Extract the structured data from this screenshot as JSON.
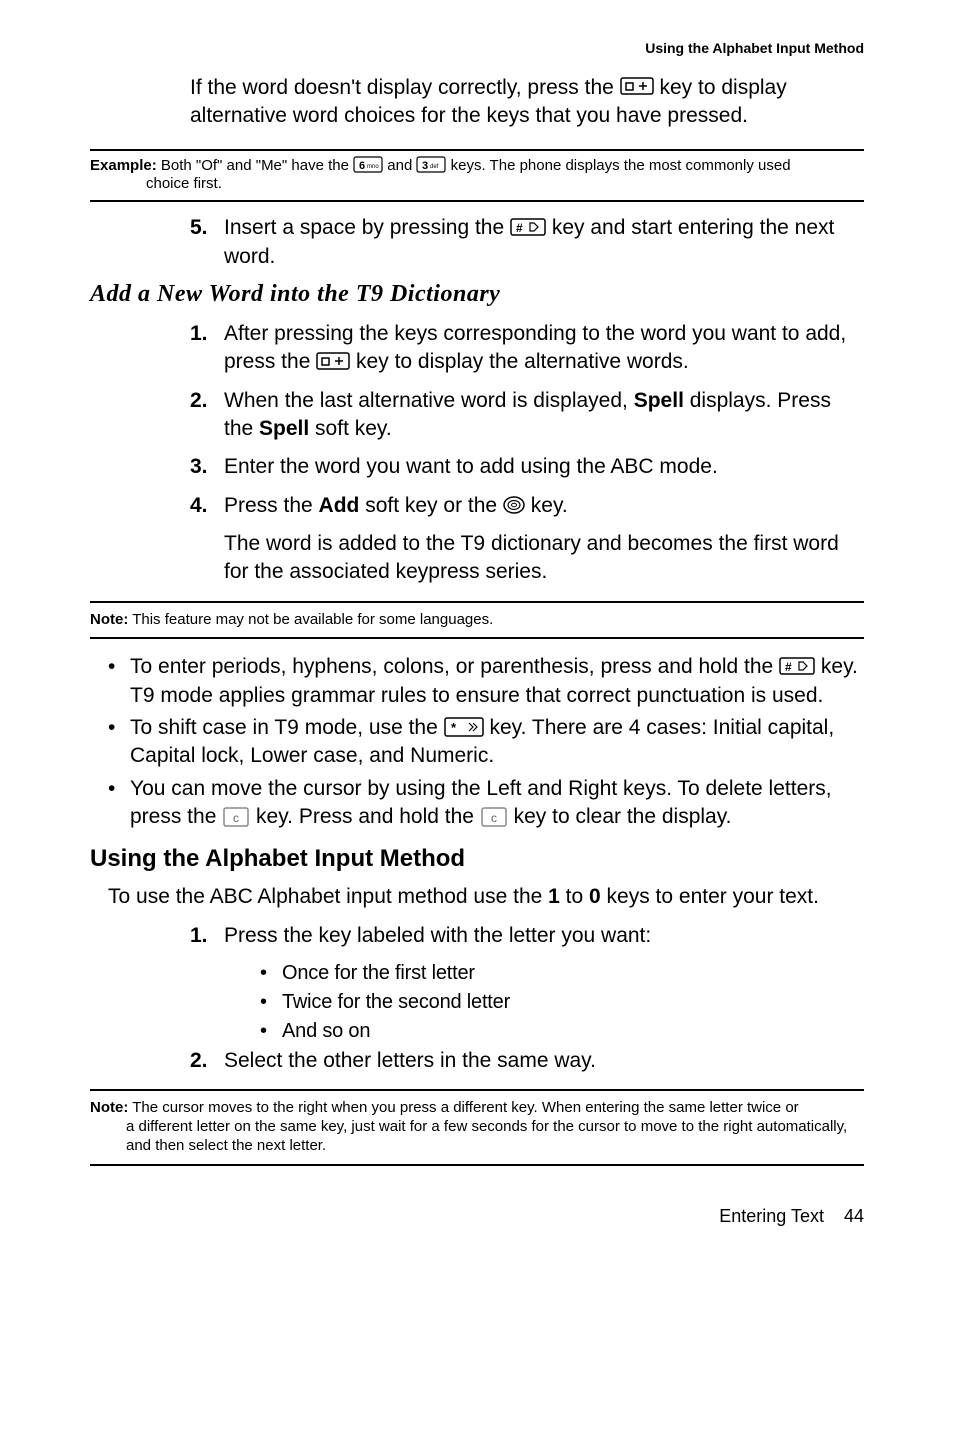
{
  "header": "Using the Alphabet Input Method",
  "intro_para": "If the word doesn't display correctly, press the {key0} key to display alternative word choices for the keys that you have pressed.",
  "example": {
    "label": "Example:",
    "text_a": " Both \"Of\" and \"Me\" have the {key6} and {key3} keys. The phone displays the most commonly used",
    "text_b": "choice first."
  },
  "step5": {
    "num": "5.",
    "text": "Insert a space by pressing the {pound} key and start entering the next word."
  },
  "section1": {
    "title": "Add a New Word into the T9 Dictionary",
    "steps": [
      {
        "num": "1.",
        "text": "After pressing the keys corresponding to the word you want to add, press the {key0} key to display the alternative words."
      },
      {
        "num": "2.",
        "text": "When the last alternative word is displayed, <b>Spell</b> displays. Press the <b>Spell</b> soft key."
      },
      {
        "num": "3.",
        "text": "Enter the word you want to add using the ABC mode."
      },
      {
        "num": "4.",
        "text": "Press the <b>Add</b> soft key or the {ok} key."
      }
    ],
    "after4": "The word is added to the T9 dictionary and becomes the first word for the associated keypress series."
  },
  "note1": {
    "label": "Note:",
    "text": " This feature may not be available for some languages."
  },
  "bullets": [
    "To enter periods, hyphens, colons, or parenthesis, press and hold the {pound} key. T9 mode applies grammar rules to ensure that correct punctuation is used.",
    "To shift case in T9 mode, use the {star} key. There are 4 cases: Initial capital, Capital lock, Lower case, and Numeric.",
    "You can move the cursor by using the Left and Right keys. To delete letters, press the {c} key. Press and hold the {c} key to clear the display."
  ],
  "section2": {
    "title": "Using the Alphabet Input Method",
    "intro": "To use the ABC Alphabet input method use the <b>1</b> to <b>0</b> keys to enter your text.",
    "steps": [
      {
        "num": "1.",
        "text": "Press the key labeled with the letter you want:"
      },
      {
        "num": "2.",
        "text": "Select the other letters in the same way."
      }
    ],
    "sub": [
      "Once for the first letter",
      "Twice for the second letter",
      "And so on"
    ]
  },
  "note2": {
    "label": "Note:",
    "text_a": " The cursor moves to the right when you press a different key. When entering the same letter twice or",
    "text_b": "a different letter on the same key, just wait for a few seconds for the cursor to move to the right automatically, and then select the next letter."
  },
  "footer": {
    "chapter": "Entering Text",
    "page": "44"
  }
}
